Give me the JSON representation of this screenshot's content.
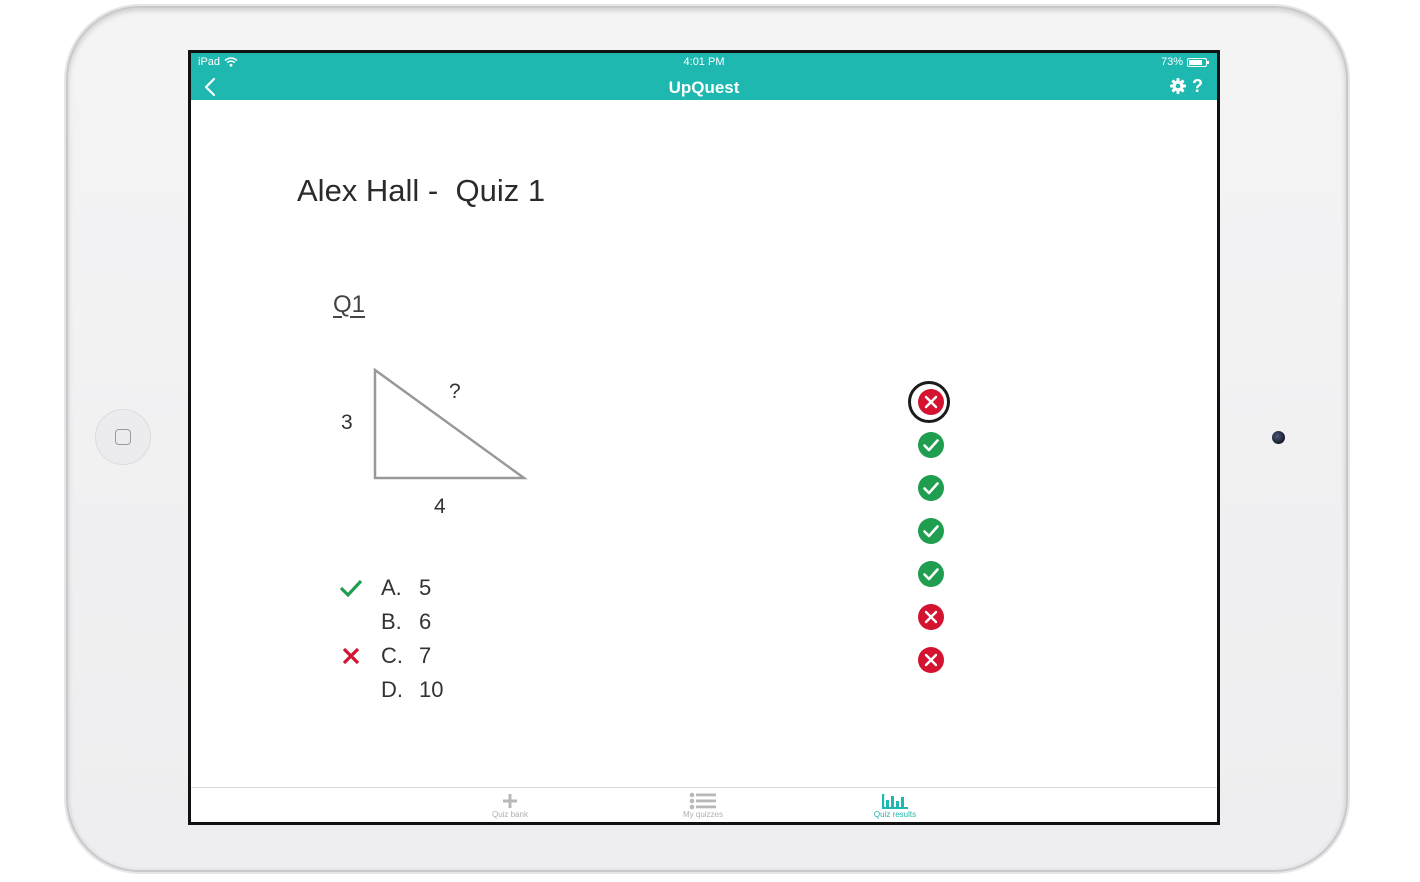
{
  "device": {
    "name": "iPad"
  },
  "status_bar": {
    "carrier": "iPad",
    "time": "4:01 PM",
    "battery": "73%"
  },
  "header": {
    "title": "UpQuest",
    "help_label": "?"
  },
  "quiz": {
    "title": "Alex Hall -  Quiz 1",
    "question_number": "Q1",
    "figure": {
      "side_a": "3",
      "side_b": "4",
      "hypotenuse": "?"
    },
    "options": [
      {
        "letter": "A.",
        "value": "5",
        "mark": "correct"
      },
      {
        "letter": "B.",
        "value": "6",
        "mark": "none"
      },
      {
        "letter": "C.",
        "value": "7",
        "mark": "wrong"
      },
      {
        "letter": "D.",
        "value": "10",
        "mark": "none"
      }
    ]
  },
  "results": [
    {
      "status": "wrong",
      "selected": true
    },
    {
      "status": "correct",
      "selected": false
    },
    {
      "status": "correct",
      "selected": false
    },
    {
      "status": "correct",
      "selected": false
    },
    {
      "status": "correct",
      "selected": false
    },
    {
      "status": "wrong",
      "selected": false
    },
    {
      "status": "wrong",
      "selected": false
    }
  ],
  "tabs": [
    {
      "label": "Quiz bank",
      "icon": "plus-icon",
      "active": false
    },
    {
      "label": "My quizzes",
      "icon": "list-icon",
      "active": false
    },
    {
      "label": "Quiz results",
      "icon": "bar-chart-icon",
      "active": true
    }
  ],
  "colors": {
    "accent": "#1eb8b1",
    "correct": "#1e9e4e",
    "wrong": "#d3132f"
  }
}
